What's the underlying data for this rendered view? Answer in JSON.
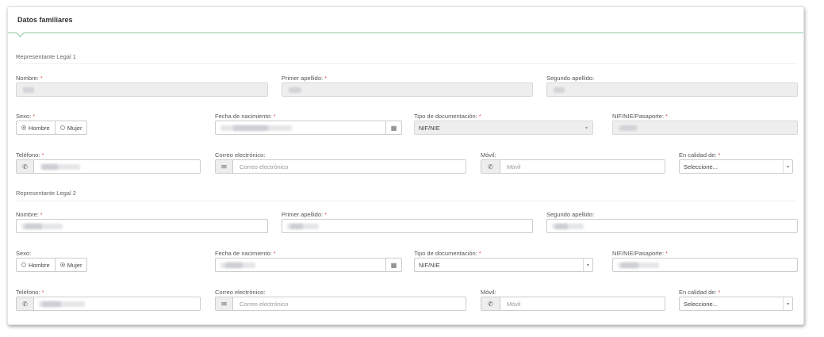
{
  "panel": {
    "title": "Datos familiares"
  },
  "rep1": {
    "section_title": "Representante Legal 1",
    "nombre_label": "Nombre:",
    "primer_apellido_label": "Primer apellido:",
    "segundo_apellido_label": "Segundo apellido:",
    "sexo_label": "Sexo:",
    "sexo_options": [
      "Hombre",
      "Mujer"
    ],
    "sexo_selected": "Hombre",
    "fecha_label": "Fecha de nacimiento:",
    "tipo_doc_label": "Tipo de documentación:",
    "tipo_doc_value": "NIF/NIE",
    "nif_label": "NIF/NIE/Pasaporte:",
    "telefono_label": "Teléfono:",
    "correo_label": "Correo electrónico:",
    "correo_placeholder": "Correo electrónico",
    "movil_label": "Móvil:",
    "movil_placeholder": "Móvil",
    "calidad_label": "En calidad de:",
    "calidad_value": "Seleccione..."
  },
  "rep2": {
    "section_title": "Representante Legal 2",
    "nombre_label": "Nombre:",
    "primer_apellido_label": "Primer apellido:",
    "segundo_apellido_label": "Segundo apellido:",
    "sexo_label": "Sexo:",
    "sexo_options": [
      "Hombre",
      "Mujer"
    ],
    "sexo_selected": "Mujer",
    "fecha_label": "Fecha de nacimiento:",
    "tipo_doc_label": "Tipo de documentación:",
    "tipo_doc_value": "NIF/NIE",
    "nif_label": "NIF/NIE/Pasaporte:",
    "telefono_label": "Teléfono:",
    "correo_label": "Correo electrónico:",
    "correo_placeholder": "Correo electrónico",
    "movil_label": "Móvil:",
    "movil_placeholder": "Móvil",
    "calidad_label": "En calidad de:",
    "calidad_value": "Seleccione..."
  },
  "required_marker": "*",
  "icons": {
    "phone": "phone-icon",
    "envelope": "envelope-icon",
    "calendar": "calendar-icon",
    "caret": "caret-down-icon"
  },
  "colors": {
    "accent": "#8fc59a",
    "required": "#d9534f",
    "disabled_bg": "#eeeeee"
  }
}
